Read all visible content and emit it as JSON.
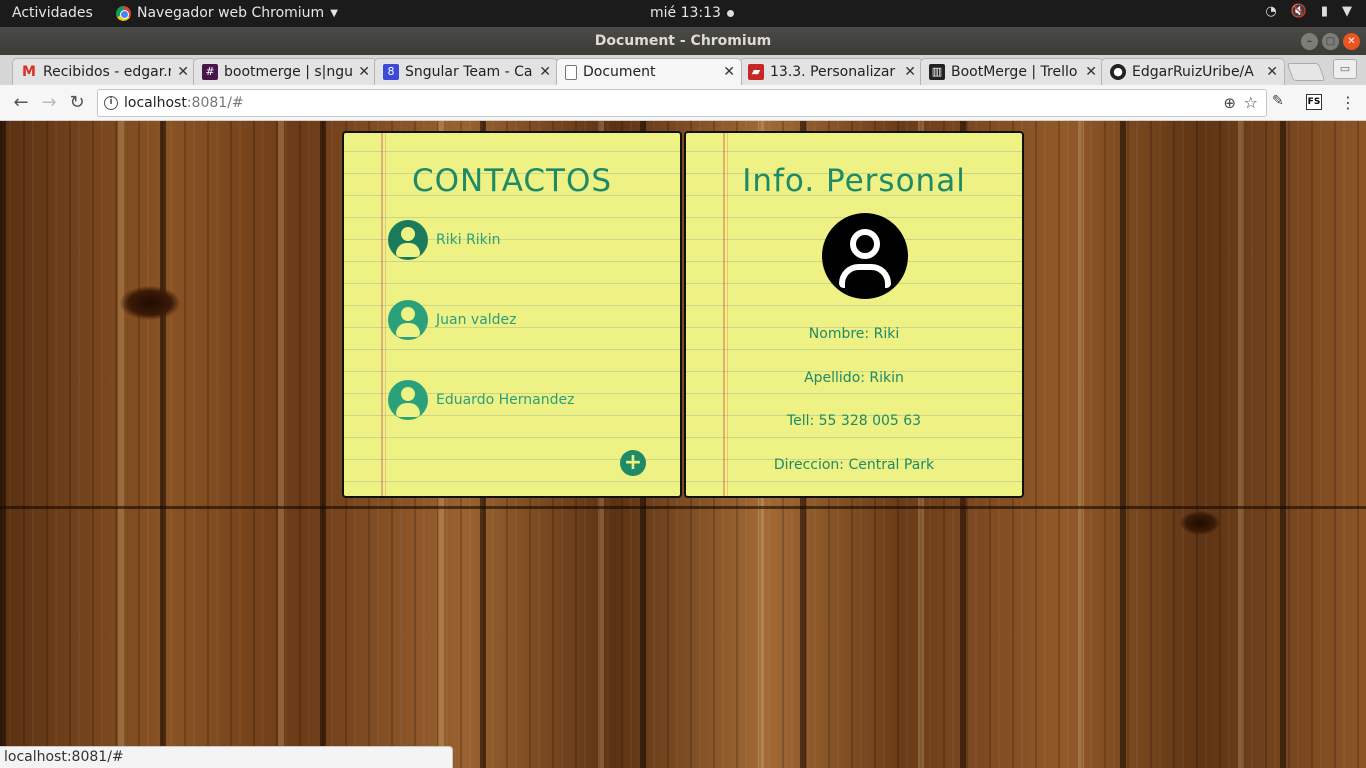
{
  "system_bar": {
    "activities": "Actividades",
    "app_name": "Navegador web Chromium",
    "clock": "mié 13:13"
  },
  "window": {
    "title": "Document - Chromium"
  },
  "tabs": [
    {
      "label": "Recibidos - edgar.r",
      "icon": "gmail-icon"
    },
    {
      "label": "bootmerge | s|ngu",
      "icon": "slack-icon"
    },
    {
      "label": "Sngular Team - Cal",
      "icon": "calendar-icon"
    },
    {
      "label": "Document",
      "icon": "document-icon",
      "active": true
    },
    {
      "label": "13.3. Personalizar",
      "icon": "book-icon"
    },
    {
      "label": "BootMerge | Trello",
      "icon": "trello-icon"
    },
    {
      "label": "EdgarRuizUribe/A",
      "icon": "github-icon"
    }
  ],
  "toolbar": {
    "url_host": "localhost",
    "url_rest": ":8081/#",
    "fs_label": "FS"
  },
  "contacts_card": {
    "title": "CONTACTOS",
    "contacts": [
      {
        "name": "Riki Rikin",
        "selected": true
      },
      {
        "name": "Juan valdez",
        "selected": false
      },
      {
        "name": "Eduardo Hernandez",
        "selected": false
      }
    ]
  },
  "info_card": {
    "title": "Info. Personal",
    "nombre": "Nombre: Riki",
    "apellido": "Apellido: Rikin",
    "telefono": "Tell: 55 328 005 63",
    "direccion": "Direccion: Central Park"
  },
  "status_bar": {
    "url": "localhost:8081/#"
  },
  "colors": {
    "accent": "#1f8a67",
    "paper": "#eef183",
    "wood": "#7a4a1e"
  }
}
